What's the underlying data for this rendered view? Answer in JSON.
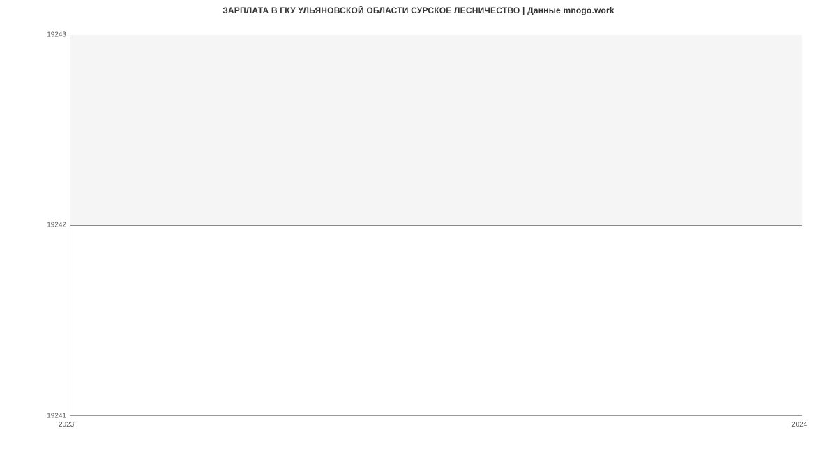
{
  "chart_data": {
    "type": "line",
    "series": [
      {
        "name": "salary",
        "x": [
          2023,
          2024
        ],
        "values": [
          19242,
          19242
        ]
      }
    ],
    "title": "ЗАРПЛАТА В ГКУ УЛЬЯНОВСКОЙ ОБЛАСТИ СУРСКОЕ ЛЕСНИЧЕСТВО | Данные mnogo.work",
    "xlabel": "",
    "ylabel": "",
    "xlim": [
      2023,
      2024
    ],
    "ylim": [
      19241,
      19243
    ],
    "x_ticks": [
      "2023",
      "2024"
    ],
    "y_ticks": [
      "19241",
      "19242",
      "19243"
    ]
  }
}
